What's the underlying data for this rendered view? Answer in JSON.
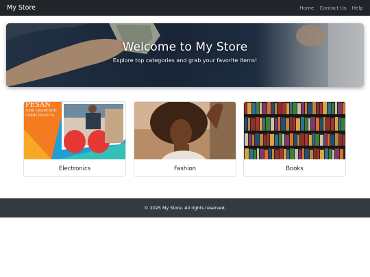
{
  "navbar": {
    "brand": "My Store",
    "links": [
      "Home",
      "Contact Us",
      "Help"
    ]
  },
  "hero": {
    "title": "Welcome to My Store",
    "subtitle": "Explore top categories and grab your favorite items!"
  },
  "categories": [
    {
      "label": "Electronics",
      "image_text": [
        "PESAN",
        "DARI GRABFOOD",
        "LEBIH PRAKTIS"
      ]
    },
    {
      "label": "Fashion"
    },
    {
      "label": "Books"
    }
  ],
  "footer": {
    "text": "© 2025 My Store. All rights reserved."
  }
}
